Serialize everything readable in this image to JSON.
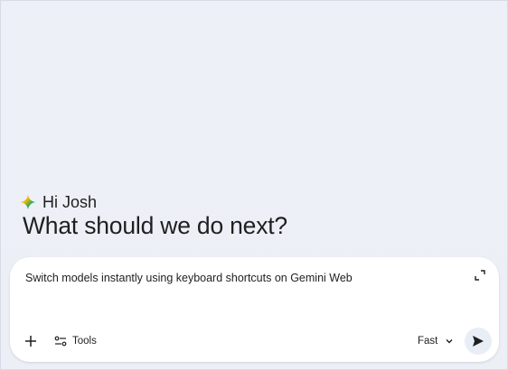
{
  "greeting": {
    "hi_text": "Hi Josh",
    "icon": "gemini-sparkle-icon"
  },
  "headline": "What should we do next?",
  "composer": {
    "prompt_text": "Switch models instantly using keyboard shortcuts on Gemini Web",
    "expand_icon": "expand-icon",
    "add_icon": "plus-icon",
    "tools_label": "Tools",
    "tools_icon": "tools-icon",
    "model_label": "Fast",
    "model_icon": "chevron-down-icon",
    "send_icon": "send-icon"
  },
  "colors": {
    "background": "#eef0f7",
    "text": "#1f1f1f",
    "sparkle_blue": "#4285f4",
    "sparkle_red": "#ea4335",
    "sparkle_yellow": "#fbbc04",
    "sparkle_green": "#34a853"
  }
}
